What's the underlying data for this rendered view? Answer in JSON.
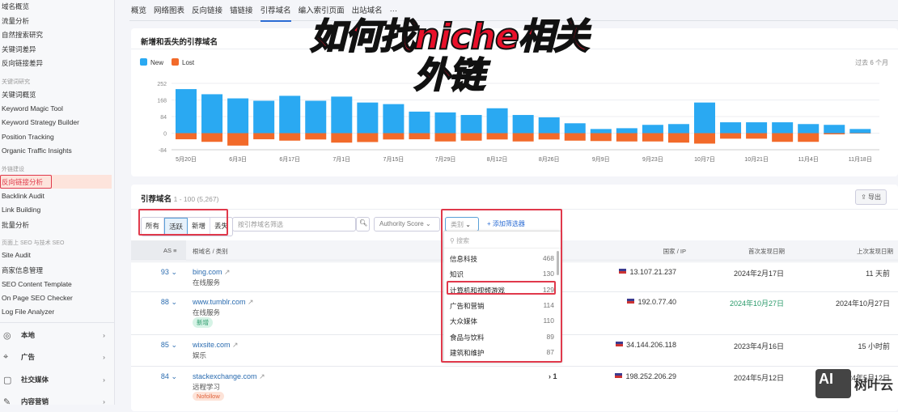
{
  "sidebar": {
    "items_top": [
      "域名概览",
      "流量分析",
      "自然搜索研究",
      "关键词差异",
      "反向链接差异"
    ],
    "kw_heading": "关键词研究",
    "kw_items": [
      "关键词概览",
      "Keyword Magic Tool",
      "Keyword Strategy Builder",
      "Position Tracking",
      "Organic Traffic Insights"
    ],
    "link_heading": "外链建设",
    "link_items": [
      "反向链接分析",
      "Backlink Audit",
      "Link Building",
      "批量分析"
    ],
    "seo_heading": "页面上 SEO 与技术 SEO",
    "seo_items": [
      "Site Audit",
      "商家信息管理",
      "SEO Content Template",
      "On Page SEO Checker",
      "Log File Analyzer"
    ],
    "sections": [
      "本地",
      "广告",
      "社交媒体",
      "内容营销"
    ]
  },
  "tabs": [
    "概览",
    "网络图表",
    "反向链接",
    "锚链接",
    "引荐域名",
    "编入索引页面",
    "出站域名",
    "···"
  ],
  "overlay": {
    "line1": "如何找niche相关",
    "line2": "外链"
  },
  "chart_card": {
    "title": "新增和丢失的引荐域名",
    "period": "过去 6 个月"
  },
  "chart_data": {
    "type": "bar",
    "title": "新增和丢失的引荐域名",
    "legend": [
      "New",
      "Lost"
    ],
    "colors": {
      "New": "#2aa9f2",
      "Lost": "#f26a2a"
    },
    "yticks": [
      252,
      168,
      84,
      0,
      -84
    ],
    "ylim": [
      -84,
      252
    ],
    "xtick_labels": [
      "5月20日",
      "6月3日",
      "6月17日",
      "7月1日",
      "7月15日",
      "7月29日",
      "8月12日",
      "8月26日",
      "9月9日",
      "9月23日",
      "10月7日",
      "10月21日",
      "11月4日",
      "11月18日"
    ],
    "series": [
      {
        "name": "New",
        "values": [
          223,
          197,
          176,
          164,
          189,
          164,
          185,
          155,
          147,
          109,
          105,
          92,
          126,
          92,
          80,
          50,
          21,
          25,
          42,
          46,
          155,
          55,
          55,
          55,
          46,
          42,
          21
        ]
      },
      {
        "name": "Lost",
        "values": [
          -31,
          -44,
          -63,
          -31,
          -38,
          -32,
          -48,
          -45,
          -32,
          -31,
          -42,
          -38,
          -32,
          -42,
          -32,
          -38,
          -40,
          -42,
          -42,
          -48,
          -53,
          -28,
          -28,
          -44,
          -44,
          -6,
          -2
        ]
      }
    ]
  },
  "table_card": {
    "title": "引荐域名",
    "range": "1 - 100 (5,267)",
    "export": "导出",
    "segments": [
      "所有",
      "活跃",
      "新增",
      "丢失"
    ],
    "search_placeholder": "按引荐域名筛选",
    "authority_select": "Authority Score",
    "category_select": "类别",
    "add_filter": "添加筛选器",
    "headers": {
      "as": "AS",
      "domain": "根域名 / 类别",
      "country": "国家 / IP",
      "first": "首次发现日期",
      "last": "上次发现日期"
    },
    "rows": [
      {
        "as": "93",
        "domain": "bing.com",
        "category": "在线服务",
        "badge": "",
        "ip": "13.107.21.237",
        "first": "2024年2月17日",
        "last": "11 天前",
        "extra": ""
      },
      {
        "as": "88",
        "domain": "www.tumblr.com",
        "category": "在线服务",
        "badge": "新增",
        "ip": "192.0.77.40",
        "first": "2024年10月27日",
        "last": "2024年10月27日",
        "extra": ""
      },
      {
        "as": "85",
        "domain": "wixsite.com",
        "category": "娱乐",
        "badge": "",
        "ip": "34.144.206.118",
        "first": "2023年4月16日",
        "last": "15 小时前",
        "extra": ""
      },
      {
        "as": "84",
        "domain": "stackexchange.com",
        "category": "远程学习",
        "badge": "Nofollow",
        "ip": "198.252.206.29",
        "first": "2024年5月12日",
        "last": "2024年5月12日",
        "extra": "1"
      }
    ]
  },
  "dropdown": {
    "search_placeholder": "搜索",
    "items": [
      {
        "label": "信息科技",
        "count": "468"
      },
      {
        "label": "知识",
        "count": "130"
      },
      {
        "label": "计算机和视频游戏",
        "count": "129"
      },
      {
        "label": "广告和营销",
        "count": "114"
      },
      {
        "label": "大众媒体",
        "count": "110"
      },
      {
        "label": "食品与饮料",
        "count": "89"
      },
      {
        "label": "建筑和维护",
        "count": "87"
      }
    ]
  },
  "watermark": {
    "logo": "AI",
    "text": "树叶云"
  }
}
